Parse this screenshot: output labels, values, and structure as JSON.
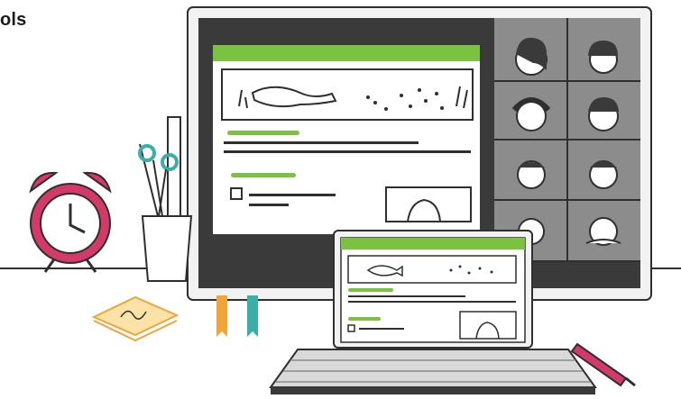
{
  "corner_text": "ols",
  "colors": {
    "ink": "#2f2f2f",
    "accent_green": "#7cc242",
    "screen_gray": "#8c8c8c",
    "monitor_frame": "#3a3a3a",
    "clock_red": "#d43a67",
    "tool_teal": "#3aaea7",
    "bookmark_orange": "#f0a43a",
    "sticky_note": "#fbe2a6"
  },
  "icons": {
    "clock": "alarm-clock-icon",
    "scissors": "scissors-icon",
    "pen": "pen-icon",
    "checkbox": "checkbox-icon"
  }
}
